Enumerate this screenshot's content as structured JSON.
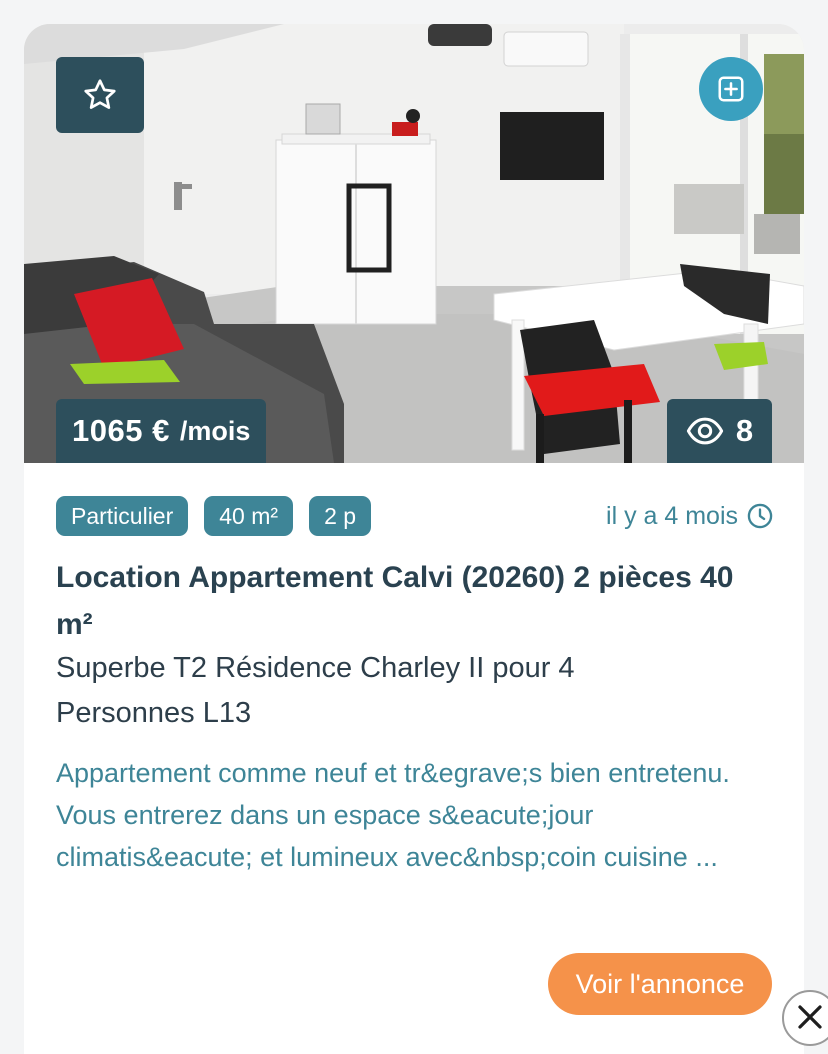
{
  "listing": {
    "price_value": "1065 €",
    "price_unit": "/mois",
    "views": "8",
    "tags": [
      "Particulier",
      "40 m²",
      "2 p"
    ],
    "posted": "il y a 4 mois",
    "title": "Location Appartement Calvi (20260) 2 pièces 40 m²",
    "subtitle": "Superbe T2 Résidence Charley II pour 4 Personnes L13",
    "description": "Appartement comme neuf et tr&egrave;s bien entretenu. Vous entrerez dans un espace s&eacute;jour climatis&eacute; et lumineux avec&nbsp;coin cuisine ...",
    "cta_label": "Voir l'annonce"
  },
  "icons": {
    "favorite": "star-icon",
    "add": "plus-square-icon",
    "views": "eye-icon",
    "time": "clock-icon",
    "close": "close-icon"
  },
  "colors": {
    "badge_dark": "#2d4f5c",
    "tag_teal": "#3e8597",
    "add_button": "#3aa0bf",
    "cta_orange": "#f5924a",
    "title_text": "#2a4250"
  }
}
